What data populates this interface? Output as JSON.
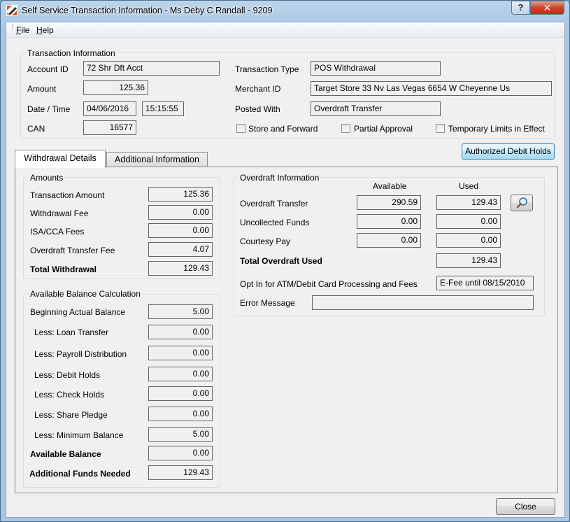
{
  "window": {
    "title": "Self Service Transaction Information - Ms Deby C Randall - 9209",
    "help_button": "?",
    "close_button": "✕"
  },
  "menu": {
    "file": "File",
    "help": "Help",
    "file_accel": "F",
    "file_rest": "ile",
    "help_accel": "H",
    "help_rest": "elp"
  },
  "transaction_info": {
    "group_label": "Transaction Information",
    "account_id_label": "Account ID",
    "account_id": "72 Shr Dft Acct",
    "amount_label": "Amount",
    "amount": "125.36",
    "datetime_label": "Date / Time",
    "date": "04/06/2016",
    "time": "15:15:55",
    "can_label": "CAN",
    "can": "16577",
    "transaction_type_label": "Transaction Type",
    "transaction_type": "POS Withdrawal",
    "merchant_id_label": "Merchant ID",
    "merchant_id": "Target Store 33  Nv Las Vegas 6654 W Cheyenne Us",
    "posted_with_label": "Posted With",
    "posted_with": "Overdraft Transfer",
    "store_forward_label": "Store and Forward",
    "store_forward_checked": false,
    "partial_approval_label": "Partial Approval",
    "partial_approval_checked": false,
    "temp_limits_label": "Temporary Limits in Effect",
    "temp_limits_checked": false
  },
  "buttons": {
    "authorized_debit_holds": "Authorized Debit Holds",
    "close": "Close"
  },
  "tabs": [
    {
      "label": "Withdrawal Details",
      "active": true
    },
    {
      "label": "Additional Information",
      "active": false
    }
  ],
  "amounts": {
    "group_label": "Amounts",
    "rows": [
      {
        "label": "Transaction Amount",
        "value": "125.36"
      },
      {
        "label": "Withdrawal Fee",
        "value": "0.00"
      },
      {
        "label": "ISA/CCA Fees",
        "value": "0.00"
      },
      {
        "label": "Overdraft Transfer Fee",
        "value": "4.07"
      },
      {
        "label": "Total Withdrawal",
        "value": "129.43"
      }
    ]
  },
  "available_balance": {
    "group_label": "Available Balance Calculation",
    "rows": [
      {
        "label": "Beginning Actual Balance",
        "value": "5.00"
      },
      {
        "label": "Less: Loan Transfer",
        "value": "0.00"
      },
      {
        "label": "Less: Payroll Distribution",
        "value": "0.00"
      },
      {
        "label": "Less: Debit Holds",
        "value": "0.00"
      },
      {
        "label": "Less: Check Holds",
        "value": "0.00"
      },
      {
        "label": "Less: Share Pledge",
        "value": "0.00"
      },
      {
        "label": "Less: Minimum Balance",
        "value": "5.00"
      },
      {
        "label": "Available Balance",
        "value": "0.00"
      },
      {
        "label": "Additional Funds Needed",
        "value": "129.43"
      }
    ]
  },
  "overdraft": {
    "group_label": "Overdraft Information",
    "col_available": "Available",
    "col_used": "Used",
    "rows": [
      {
        "label": "Overdraft Transfer",
        "available": "290.59",
        "used": "129.43"
      },
      {
        "label": "Uncollected Funds",
        "available": "0.00",
        "used": "0.00"
      },
      {
        "label": "Courtesy Pay",
        "available": "0.00",
        "used": "0.00"
      }
    ],
    "total_label": "Total Overdraft Used",
    "total_used": "129.43",
    "opt_in_label": "Opt In for ATM/Debit Card Processing and Fees",
    "opt_in_value": "E-Fee until 08/15/2010",
    "error_label": "Error Message",
    "error_value": "",
    "lookup_icon": "magnifier-icon"
  }
}
